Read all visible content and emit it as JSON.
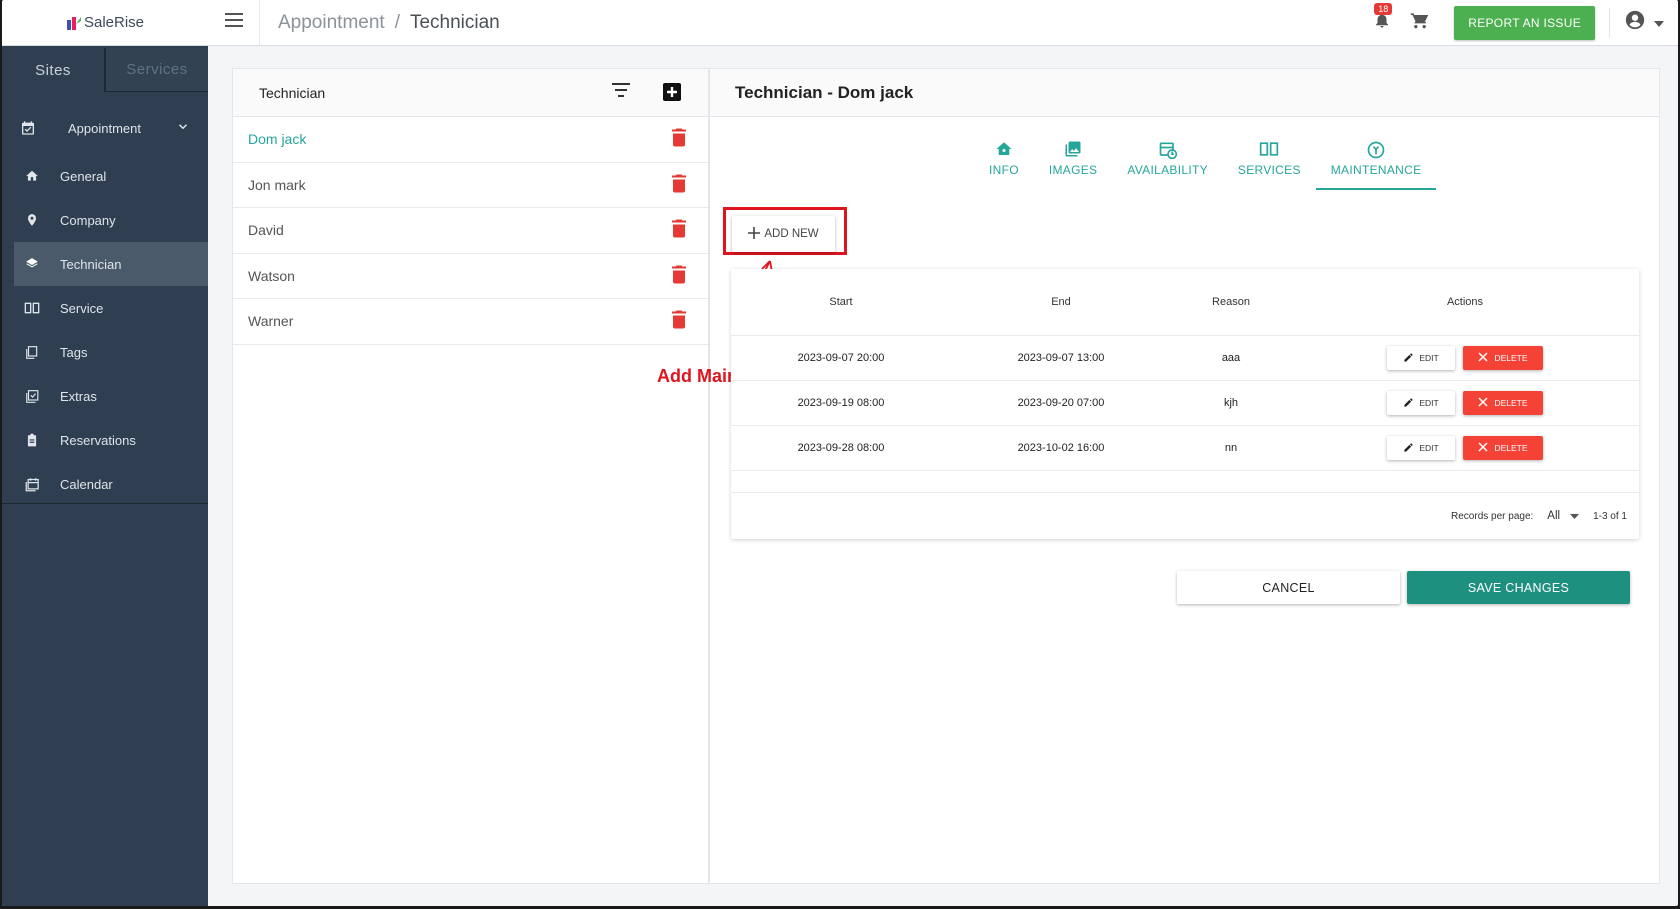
{
  "app": {
    "logo_text": "SaleRise"
  },
  "topbar": {
    "breadcrumb": [
      "Appointment",
      "Technician"
    ],
    "separator": "/",
    "notification_count": "18",
    "report_label": "REPORT AN ISSUE"
  },
  "sidebar": {
    "site_tabs": [
      "Sites",
      "Services"
    ],
    "parent_label": "Appointment",
    "items": [
      {
        "label": "General",
        "icon": "home-icon"
      },
      {
        "label": "Company",
        "icon": "location-pin-icon"
      },
      {
        "label": "Technician",
        "icon": "layers-icon",
        "active": true
      },
      {
        "label": "Service",
        "icon": "book-icon"
      },
      {
        "label": "Tags",
        "icon": "tag-document-icon"
      },
      {
        "label": "Extras",
        "icon": "checklist-icon"
      },
      {
        "label": "Reservations",
        "icon": "clipboard-icon"
      },
      {
        "label": "Calendar",
        "icon": "calendar-icon"
      }
    ]
  },
  "technician_list": {
    "title": "Technician",
    "items": [
      "Dom jack",
      "Jon mark",
      "David",
      "Watson",
      "Warner"
    ],
    "selected": "Dom jack"
  },
  "detail": {
    "title": "Technician - Dom jack",
    "tabs": [
      "INFO",
      "IMAGES",
      "AVAILABILITY",
      "SERVICES",
      "MAINTENANCE"
    ],
    "active_tab": "MAINTENANCE",
    "add_new_label": "ADD NEW",
    "annotation": "Add Maintenance",
    "table": {
      "headers": [
        "Start",
        "End",
        "Reason",
        "Actions"
      ],
      "rows": [
        {
          "start": "2023-09-07 20:00",
          "end": "2023-09-07 13:00",
          "reason": "aaa"
        },
        {
          "start": "2023-09-19 08:00",
          "end": "2023-09-20 07:00",
          "reason": "kjh"
        },
        {
          "start": "2023-09-28 08:00",
          "end": "2023-10-02 16:00",
          "reason": "nn"
        }
      ],
      "edit_label": "EDIT",
      "delete_label": "DELETE",
      "records_per_page_label": "Records per page:",
      "records_per_page_value": "All",
      "pagination": "1-3 of 1"
    },
    "cancel_label": "CANCEL",
    "save_label": "SAVE CHANGES"
  },
  "colors": {
    "sidebar_bg": "#2f3e50",
    "accent_teal": "#26a69a",
    "report_green": "#4caf50",
    "delete_red": "#f44336",
    "annotation_red": "#e0141e"
  }
}
